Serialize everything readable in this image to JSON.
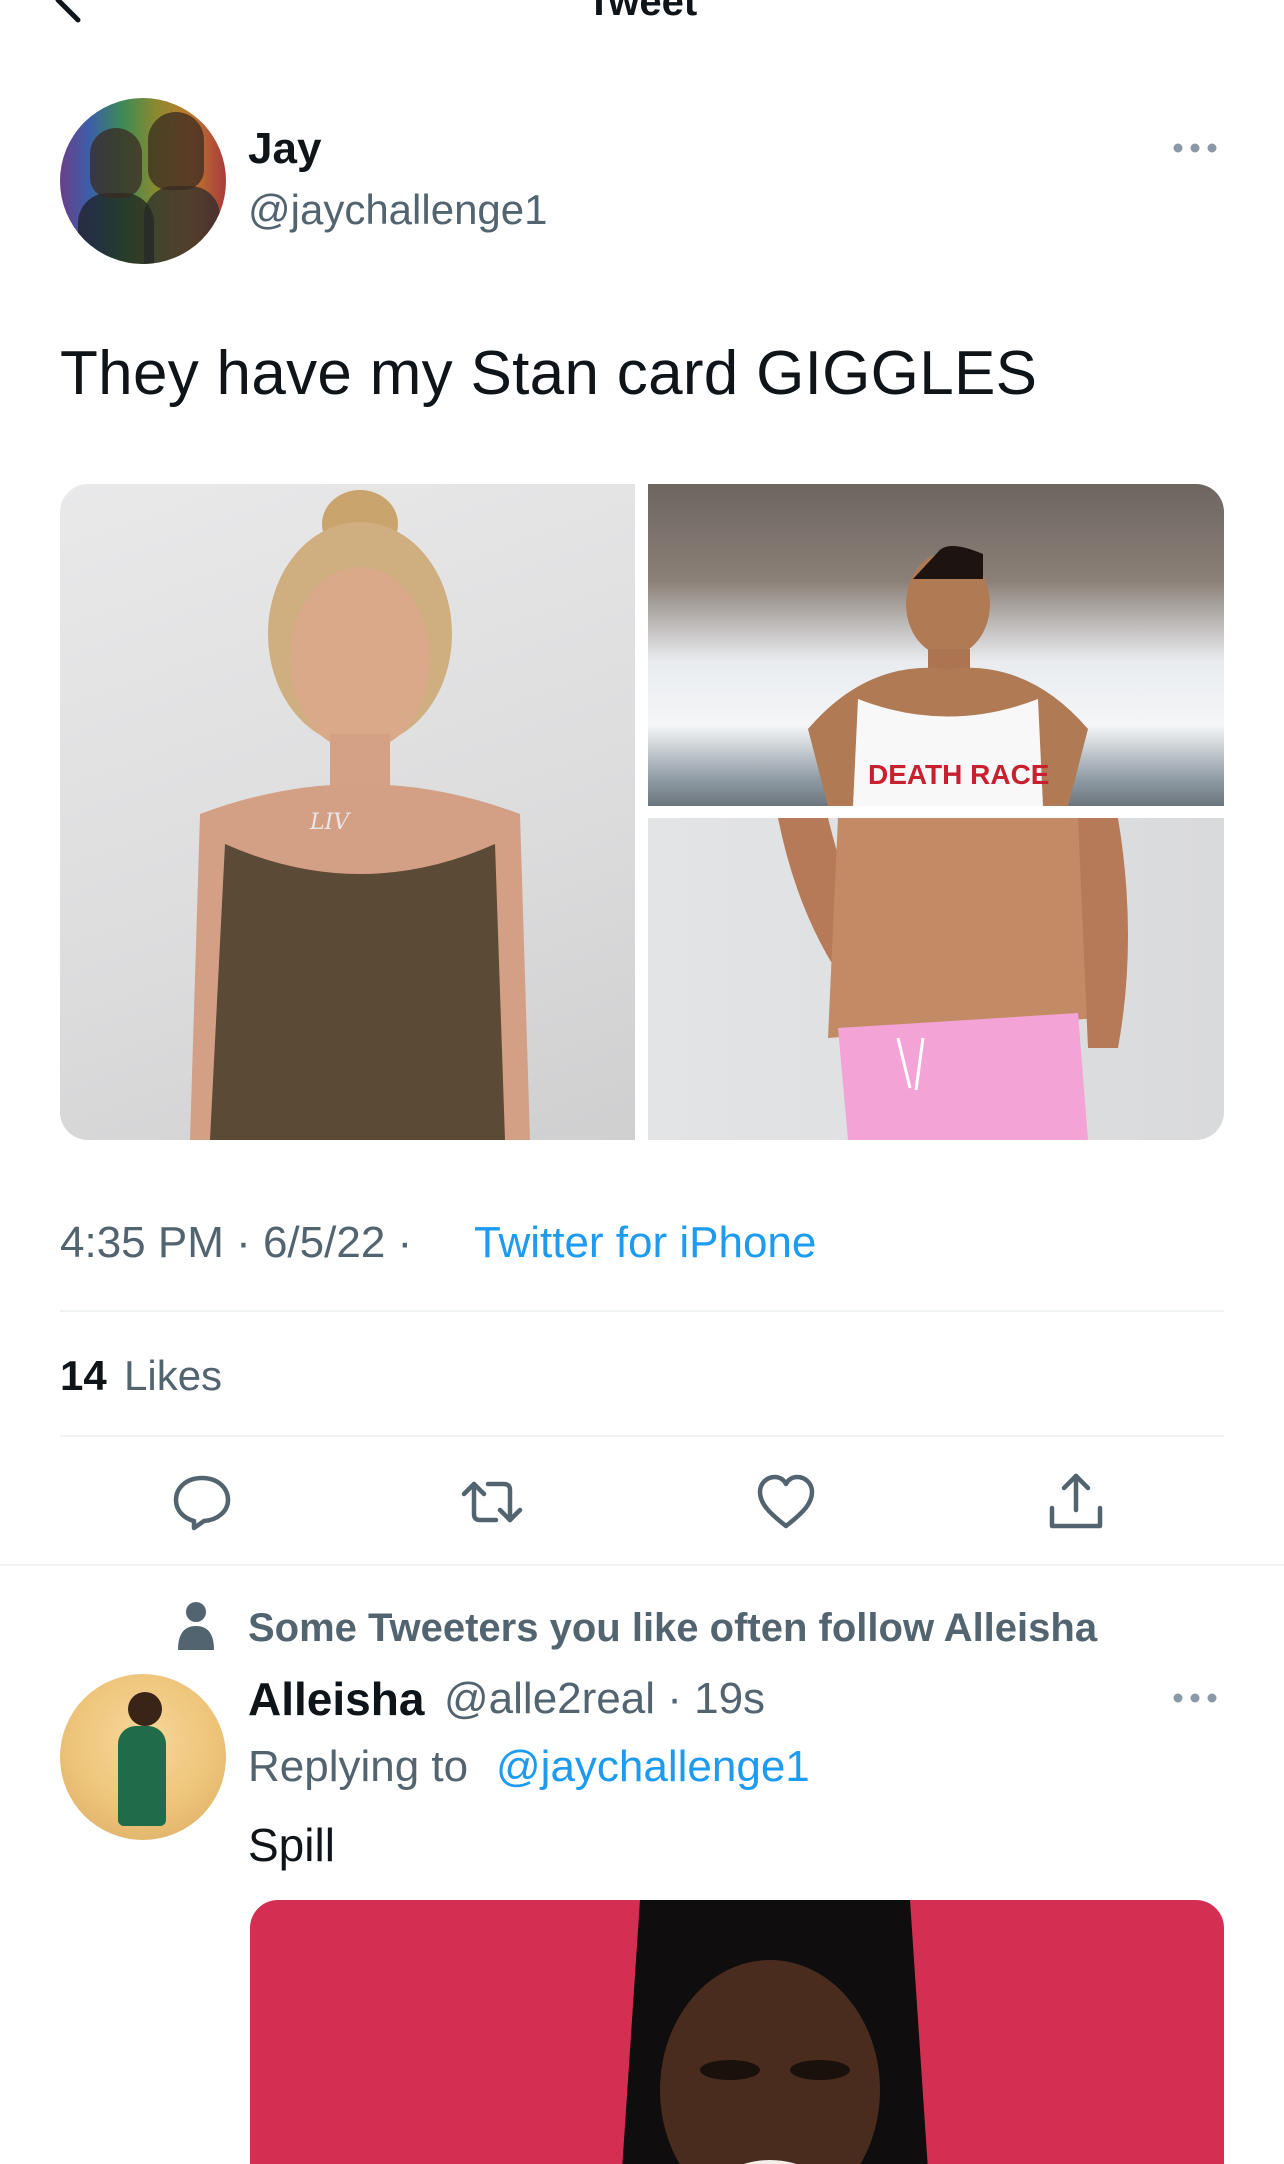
{
  "header": {
    "title": "Tweet",
    "back_icon": "chevron-left-icon"
  },
  "tweet": {
    "author_name": "Jay",
    "author_handle": "@jaychallenge1",
    "text": "They have my Stan card GIGGLES",
    "media": [
      {
        "name": "photo-liv",
        "caption_on_image": "LIV"
      },
      {
        "name": "photo-death-race",
        "caption_on_image": "DEATH RACE"
      },
      {
        "name": "photo-pink-shorts"
      }
    ],
    "time": "4:35 PM · 6/5/22 · ",
    "source": "Twitter for iPhone",
    "likes_count": "14",
    "likes_label": "Likes",
    "actions": [
      "reply-icon",
      "retweet-icon",
      "like-icon",
      "share-icon"
    ],
    "colors": {
      "link": "#1d9bf0",
      "secondary": "#536471",
      "primary": "#0f1419"
    }
  },
  "reply": {
    "social_context": "Some Tweeters you like often follow Alleisha",
    "author_name": "Alleisha",
    "meta": "@alle2real · 19s",
    "replying_prefix": "Replying to",
    "replying_handle": "@jaychallenge1",
    "text": "Spill"
  }
}
